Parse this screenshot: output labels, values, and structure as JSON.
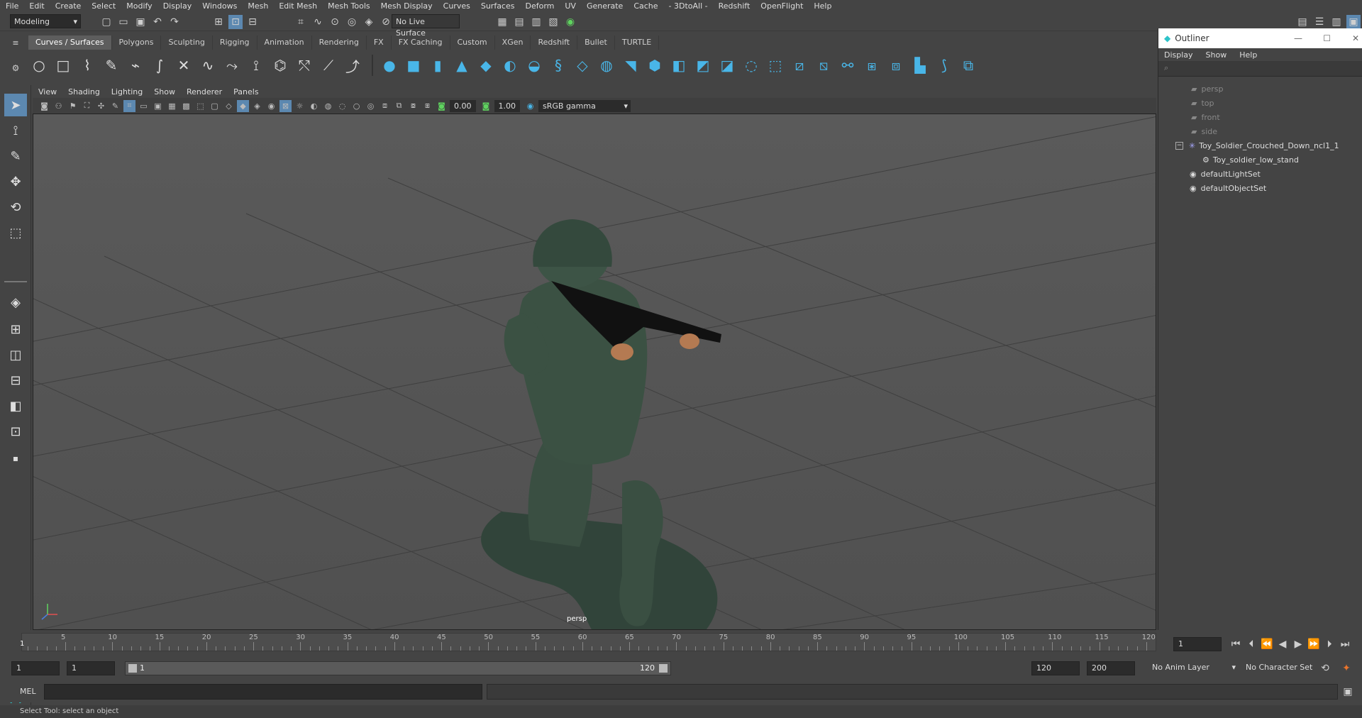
{
  "menubar": [
    "File",
    "Edit",
    "Create",
    "Select",
    "Modify",
    "Display",
    "Windows",
    "Mesh",
    "Edit Mesh",
    "Mesh Tools",
    "Mesh Display",
    "Curves",
    "Surfaces",
    "Deform",
    "UV",
    "Generate",
    "Cache",
    "- 3DtoAll -",
    "Redshift",
    "OpenFlight",
    "Help"
  ],
  "status": {
    "mode": "Modeling",
    "live_surface": "No Live Surface"
  },
  "shelf_tabs": [
    "Curves / Surfaces",
    "Polygons",
    "Sculpting",
    "Rigging",
    "Animation",
    "Rendering",
    "FX",
    "FX Caching",
    "Custom",
    "XGen",
    "Redshift",
    "Bullet",
    "TURTLE"
  ],
  "shelf_active": "Curves / Surfaces",
  "viewport_menu": [
    "View",
    "Shading",
    "Lighting",
    "Show",
    "Renderer",
    "Panels"
  ],
  "viewport": {
    "exposure": "0.00",
    "gamma": "1.00",
    "color_space": "sRGB gamma",
    "camera_label": "persp"
  },
  "outliner": {
    "title": "Outliner",
    "menu": [
      "Display",
      "Show",
      "Help"
    ],
    "items": [
      {
        "label": "persp",
        "dim": true
      },
      {
        "label": "top",
        "dim": true
      },
      {
        "label": "front",
        "dim": true
      },
      {
        "label": "side",
        "dim": true
      },
      {
        "label": "Toy_Soldier_Crouched_Down_ncl1_1",
        "dim": false
      },
      {
        "label": "Toy_soldier_low_stand",
        "dim": false
      },
      {
        "label": "defaultLightSet",
        "dim": false
      },
      {
        "label": "defaultObjectSet",
        "dim": false
      }
    ]
  },
  "timeline": {
    "ticks": [
      "5",
      "10",
      "15",
      "20",
      "25",
      "30",
      "35",
      "40",
      "45",
      "50",
      "55",
      "60",
      "65",
      "70",
      "75",
      "80",
      "85",
      "90",
      "95",
      "100",
      "105",
      "110",
      "115",
      "120"
    ],
    "current_frame": "1",
    "current_frame_field": "1"
  },
  "range": {
    "start_field": "1",
    "start_field2": "1",
    "slider_start": "1",
    "slider_end": "120",
    "end_field": "120",
    "end_field2": "200",
    "anim_layer": "No Anim Layer",
    "char_set": "No Character Set"
  },
  "command": {
    "lang": "MEL"
  },
  "help_line": "Select Tool: select an object"
}
